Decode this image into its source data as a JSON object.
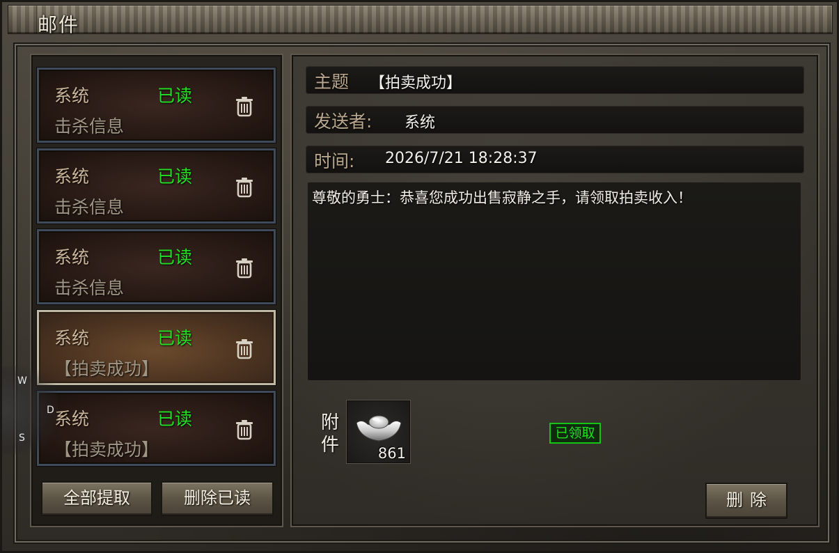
{
  "window": {
    "title": "邮件"
  },
  "mail_list": [
    {
      "sender": "系统",
      "status": "已读",
      "subject": "击杀信息",
      "selected": false
    },
    {
      "sender": "系统",
      "status": "已读",
      "subject": "击杀信息",
      "selected": false
    },
    {
      "sender": "系统",
      "status": "已读",
      "subject": "击杀信息",
      "selected": false
    },
    {
      "sender": "系统",
      "status": "已读",
      "subject": "【拍卖成功】",
      "selected": true
    },
    {
      "sender": "系统",
      "status": "已读",
      "subject": "【拍卖成功】",
      "selected": false
    }
  ],
  "list_actions": {
    "collect_all": "全部提取",
    "delete_read": "删除已读"
  },
  "detail": {
    "subject_label": "主题",
    "subject_value": "【拍卖成功】",
    "sender_label": "发送者:",
    "sender_value": "系统",
    "time_label": "时间:",
    "time_value": "2026/7/21 18:28:37",
    "body": "尊敬的勇士：恭喜您成功出售寂静之手，请领取拍卖收入！",
    "attachment_label": "附件",
    "attachment": {
      "icon": "silver-ingot-icon",
      "count": "861"
    },
    "claimed_status": "已领取",
    "delete_button": "删除"
  },
  "overlay_keys": {
    "w": "W",
    "d": "D",
    "s": "S"
  },
  "colors": {
    "read_status": "#22e022",
    "claimed": "#22e022"
  }
}
